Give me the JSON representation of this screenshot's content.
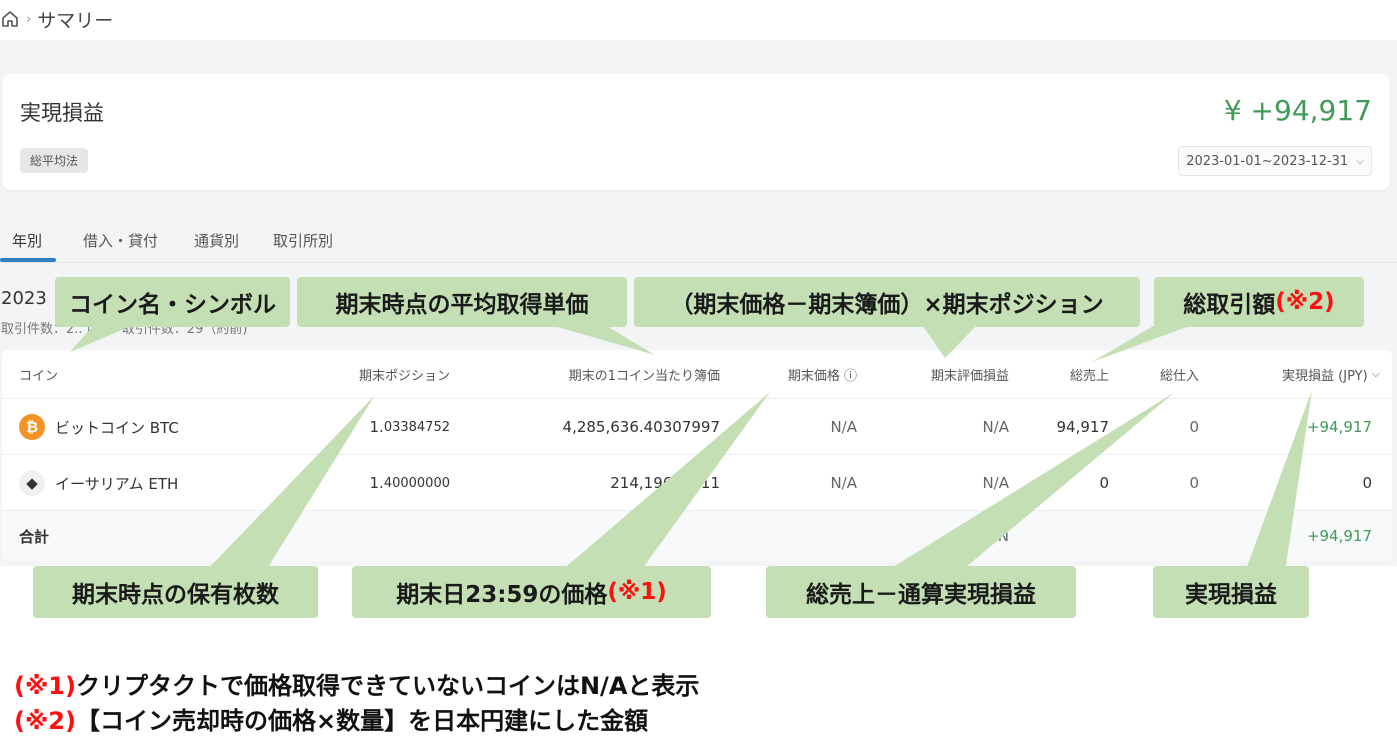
{
  "breadcrumb": {
    "home_icon": "home-icon",
    "sep": "›",
    "page": "サマリー"
  },
  "summary": {
    "title": "実現損益",
    "method": "総平均法",
    "pl_value": "¥ +94,917",
    "date_range": "2023-01-01~2023-12-31",
    "date_chev": "⌵"
  },
  "tabs": [
    "年別",
    "借入・貸付",
    "通貨別",
    "取引所別"
  ],
  "year": {
    "label": "2023",
    "subline": "取引件数：2.. 度)・ 取引件数：29（約前)"
  },
  "table": {
    "headers": {
      "coin": "コイン",
      "position": "期末ポジション",
      "book": "期末の1コイン当たり簿価",
      "price": "期末価格 ⓘ",
      "eval": "期末評価損益",
      "sales": "総売上",
      "purchase": "総仕入",
      "pl": "実現損益 (JPY)",
      "pl_chev": "⌵"
    },
    "rows": [
      {
        "icon": "bitcoin-icon",
        "icon_glyph": "₿",
        "name": "ビットコイン BTC",
        "pos_big": "1.",
        "pos_small": "03384752",
        "book": "4,285,636.40307997",
        "price": "N/A",
        "eval": "N/A",
        "sales": "94,917",
        "purchase": "0",
        "pl": "+94,917"
      },
      {
        "icon": "ethereum-icon",
        "icon_glyph": "◆",
        "name": "イーサリアム ETH",
        "pos_big": "1.",
        "pos_small": "40000000",
        "book": "214,196.11   11",
        "price": "N/A",
        "eval": "N/A",
        "sales": "0",
        "purchase": "0",
        "pl": "0"
      }
    ],
    "total": {
      "label": "合計",
      "eval": "N",
      "pl": "+94,917"
    }
  },
  "annotations": {
    "coin_name": "コイン名・シンボル",
    "avg_cost": "期末時点の平均取得単価",
    "eval_formula": "（期末価格－期末簿価）×期末ポジション",
    "total_trade": "総取引額",
    "total_trade_note": "(※2)",
    "holdings": "期末時点の保有枚数",
    "price_at": "期末日23:59の価格",
    "price_note": "(※1)",
    "sales_formula": "総売上－通算実現損益",
    "realized": "実現損益"
  },
  "notes": [
    {
      "mark": "(※1)",
      "text": "クリプタクトで価格取得できていないコインはN/Aと表示"
    },
    {
      "mark": "(※2)",
      "text": "【コイン売却時の価格×数量】を日本円建にした金額"
    }
  ]
}
